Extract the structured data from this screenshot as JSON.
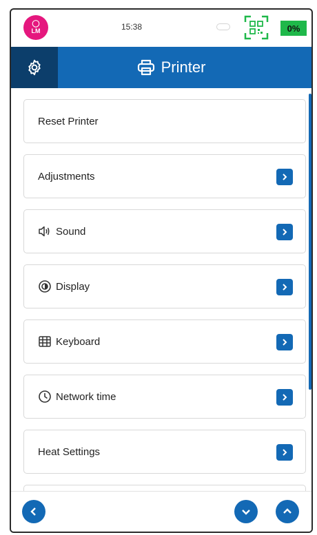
{
  "status": {
    "avatar_initials": "LM",
    "time": "15:38",
    "battery": "0%"
  },
  "header": {
    "title": "Printer"
  },
  "menu": {
    "items": [
      {
        "label": "Reset Printer"
      },
      {
        "label": "Adjustments"
      },
      {
        "label": "Sound"
      },
      {
        "label": "Display"
      },
      {
        "label": "Keyboard"
      },
      {
        "label": "Network time"
      },
      {
        "label": "Heat Settings"
      }
    ]
  },
  "colors": {
    "primary": "#1369b5",
    "primary_dark": "#0c3e6b",
    "avatar": "#e5177e",
    "battery": "#1fb84a",
    "qr": "#1fb84a"
  },
  "icons": {
    "settings": "gear-icon",
    "title": "printer-icon",
    "sound": "speaker-icon",
    "display": "brightness-icon",
    "keyboard": "keyboard-icon",
    "network_time": "clock-icon",
    "chevron": "chevron-right-icon",
    "back": "chevron-left-icon",
    "scroll_down": "chevron-down-icon",
    "scroll_up": "chevron-up-icon",
    "qr": "qr-scan-icon"
  }
}
